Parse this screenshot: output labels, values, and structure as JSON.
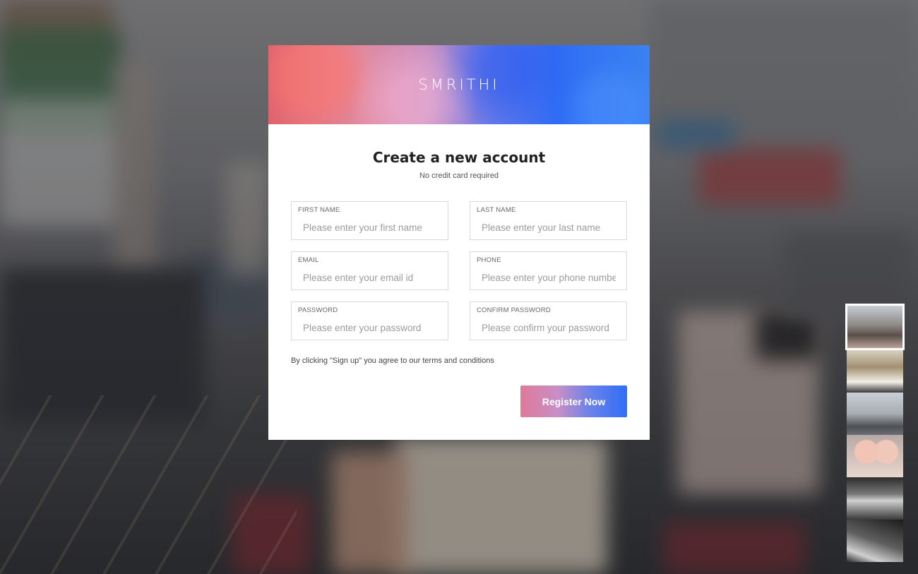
{
  "brand": "SMRITHI",
  "form": {
    "title": "Create a new account",
    "subtitle": "No credit card required",
    "fields": {
      "first_name": {
        "label": "FIRST NAME",
        "placeholder": "Please enter your first name"
      },
      "last_name": {
        "label": "LAST NAME",
        "placeholder": "Please enter your last name"
      },
      "email": {
        "label": "EMAIL",
        "placeholder": "Please enter your email id"
      },
      "phone": {
        "label": "PHONE",
        "placeholder": "Please enter your phone number"
      },
      "password": {
        "label": "PASSWORD",
        "placeholder": "Please enter your password"
      },
      "confirm_password": {
        "label": "CONFIRM PASSWORD",
        "placeholder": "Please confirm your password"
      }
    },
    "terms": "By clicking \"Sign up\" you agree to our terms and conditions",
    "register_label": "Register Now"
  },
  "thumbnails": {
    "active_index": 0,
    "items": [
      "street-scene",
      "city-street",
      "city-skyline",
      "babies",
      "interior-bw",
      "street-bw"
    ]
  },
  "colors": {
    "button_gradient_start": "#e07a9a",
    "button_gradient_end": "#2f6ef5",
    "header_gradient_start": "#e0636d",
    "header_gradient_end": "#3a82f2"
  }
}
